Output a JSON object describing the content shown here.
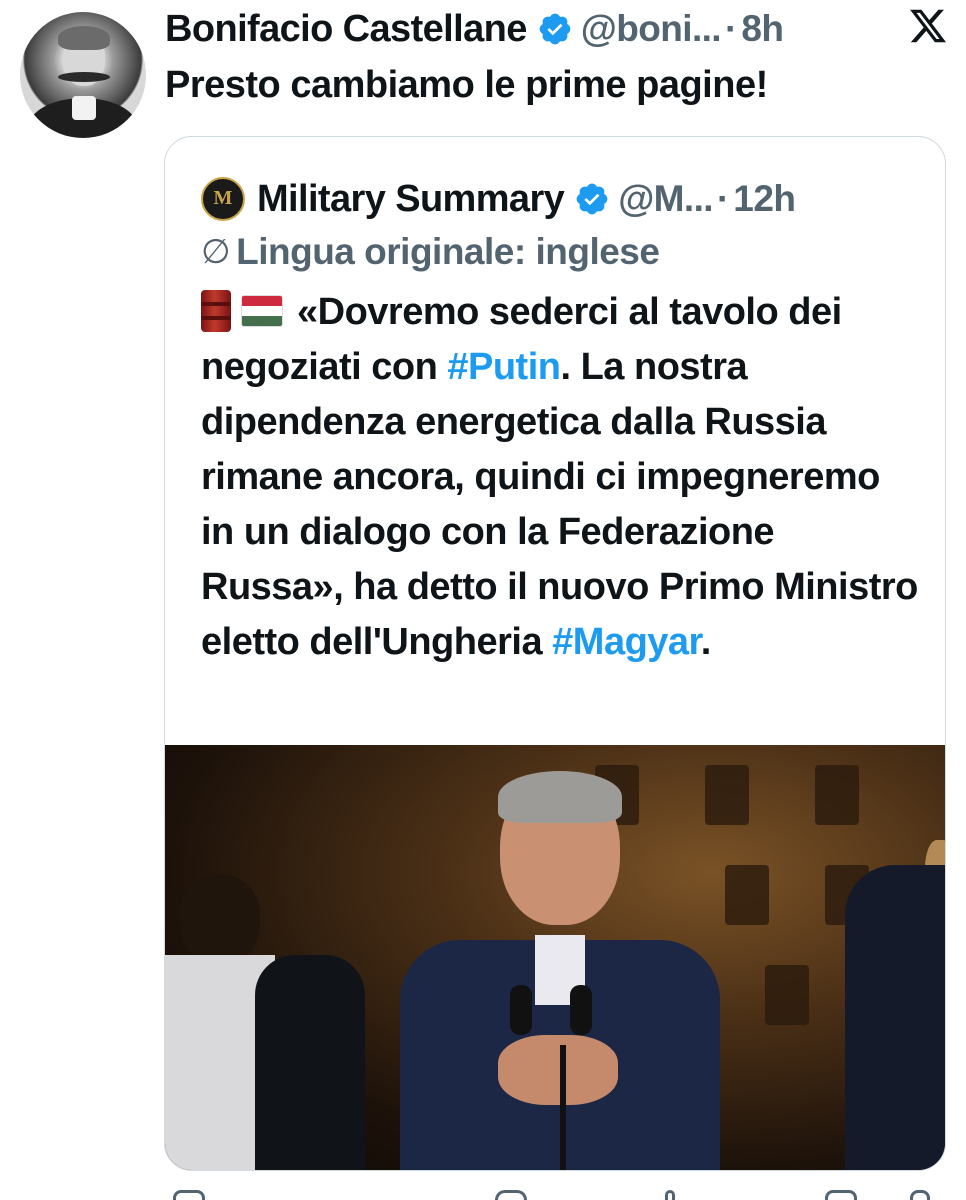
{
  "tweet": {
    "author": {
      "name": "Bonifacio Castellane",
      "handle": "@boni...",
      "verified": true
    },
    "separator": "·",
    "time": "8h",
    "text": "Presto cambiamo le prime pagine!"
  },
  "quoted_tweet": {
    "author": {
      "name": "Military Summary",
      "handle": "@M...",
      "verified": true
    },
    "separator": "·",
    "time": "12h",
    "translation_icon": "∅",
    "translation_label": "Lingua originale: inglese",
    "text_segments": {
      "part1": "«Dovremo sederci al tavolo dei negoziati con ",
      "hashtag1": "#Putin",
      "part2": ". La nostra dipendenza energetica dalla Russia rimane ancora, quindi ci impegneremo in un dialogo con la Federazione Russa», ha detto il nuovo Primo Ministro eletto dell'Ungheria ",
      "hashtag2": "#Magyar",
      "part3": "."
    },
    "emojis": [
      "oil-drum-emoji",
      "hungary-flag-emoji"
    ]
  },
  "colors": {
    "text": "#0f1419",
    "secondary": "#536471",
    "hashtag": "#1d9bf0",
    "verified_badge": "#1d9bf0",
    "card_border": "#cfd9de"
  },
  "icons": [
    "x-logo-icon",
    "verified-badge-icon",
    "translate-icon"
  ]
}
